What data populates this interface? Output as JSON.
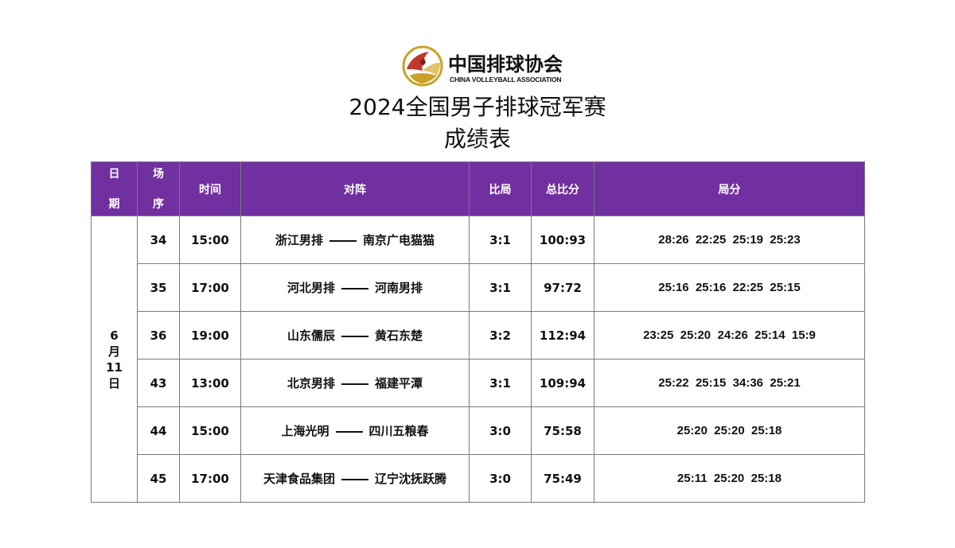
{
  "header": {
    "logo_cn": "中国排球协会",
    "logo_en": "CHINA VOLLEYBALL ASSOCIATION",
    "title": "2024全国男子排球冠军赛",
    "subtitle": "成绩表"
  },
  "colors": {
    "header_bg": "#7030a0",
    "header_text": "#ffffff",
    "logo_red": "#c0392b",
    "logo_gold": "#c9a227"
  },
  "table": {
    "columns": {
      "date_top": "日",
      "date_bottom": "期",
      "seq_top": "场",
      "seq_bottom": "序",
      "time": "时间",
      "matchup": "对阵",
      "set_score": "比局",
      "total_points": "总比分",
      "set_points": "局分"
    },
    "date": {
      "l1": "6",
      "l2": "月",
      "l3": "11",
      "l4": "日"
    },
    "rows": [
      {
        "seq": "34",
        "time": "15:00",
        "home": "浙江男排",
        "away": "南京广电猫猫",
        "set_score": "3:1",
        "total": "100:93",
        "sets": "28:26  22:25  25:19  25:23"
      },
      {
        "seq": "35",
        "time": "17:00",
        "home": "河北男排",
        "away": "河南男排",
        "set_score": "3:1",
        "total": "97:72",
        "sets": "25:16  25:16  22:25  25:15"
      },
      {
        "seq": "36",
        "time": "19:00",
        "home": "山东儒辰",
        "away": "黄石东楚",
        "set_score": "3:2",
        "total": "112:94",
        "sets": "23:25  25:20  24:26  25:14  15:9"
      },
      {
        "seq": "43",
        "time": "13:00",
        "home": "北京男排",
        "away": "福建平潭",
        "set_score": "3:1",
        "total": "109:94",
        "sets": "25:22  25:15  34:36  25:21"
      },
      {
        "seq": "44",
        "time": "15:00",
        "home": "上海光明",
        "away": "四川五粮春",
        "set_score": "3:0",
        "total": "75:58",
        "sets": "25:20  25:20  25:18"
      },
      {
        "seq": "45",
        "time": "17:00",
        "home": "天津食品集团",
        "away": "辽宁沈抚跃腾",
        "set_score": "3:0",
        "total": "75:49",
        "sets": "25:11  25:20  25:18"
      }
    ]
  }
}
